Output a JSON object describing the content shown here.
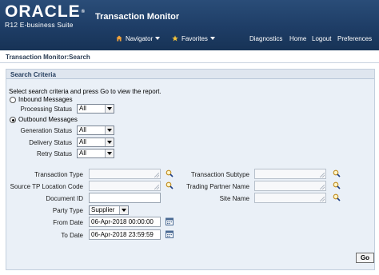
{
  "header": {
    "logo_text": "ORACLE",
    "logo_reg": "®",
    "logo_sub": "R12 E-business Suite",
    "app_title": "Transaction Monitor",
    "nav": {
      "navigator": "Navigator",
      "favorites": "Favorites",
      "diagnostics": "Diagnostics",
      "home": "Home",
      "logout": "Logout",
      "preferences": "Preferences"
    }
  },
  "breadcrumb": "Transaction Monitor:Search",
  "search": {
    "section_title": "Search Criteria",
    "instructions": "Select search criteria and press Go to view the report.",
    "inbound": {
      "label": "Inbound Messages",
      "selected": false,
      "processing_status_label": "Processing Status",
      "processing_status_value": "All"
    },
    "outbound": {
      "label": "Outbound Messages",
      "selected": true,
      "generation_status_label": "Generation Status",
      "generation_status_value": "All",
      "delivery_status_label": "Delivery Status",
      "delivery_status_value": "All",
      "retry_status_label": "Retry Status",
      "retry_status_value": "All"
    },
    "fields": {
      "transaction_type_label": "Transaction Type",
      "transaction_type_value": "",
      "source_tp_location_label": "Source TP Location Code",
      "source_tp_location_value": "",
      "document_id_label": "Document ID",
      "document_id_value": "",
      "party_type_label": "Party Type",
      "party_type_value": "Supplier",
      "from_date_label": "From Date",
      "from_date_value": "06-Apr-2018 00:00:00",
      "to_date_label": "To Date",
      "to_date_value": "06-Apr-2018 23:59:59",
      "transaction_subtype_label": "Transaction Subtype",
      "transaction_subtype_value": "",
      "trading_partner_name_label": "Trading Partner Name",
      "trading_partner_name_value": "",
      "site_name_label": "Site Name",
      "site_name_value": ""
    },
    "go_label": "Go"
  },
  "colors": {
    "header_bg": "#1e3d66",
    "panel_bg": "#eaf0f7",
    "panel_title_bg": "#dfe6ef",
    "title_text": "#263f5f"
  },
  "icons": [
    "home-icon",
    "star-icon",
    "search-icon",
    "calendar-icon"
  ]
}
